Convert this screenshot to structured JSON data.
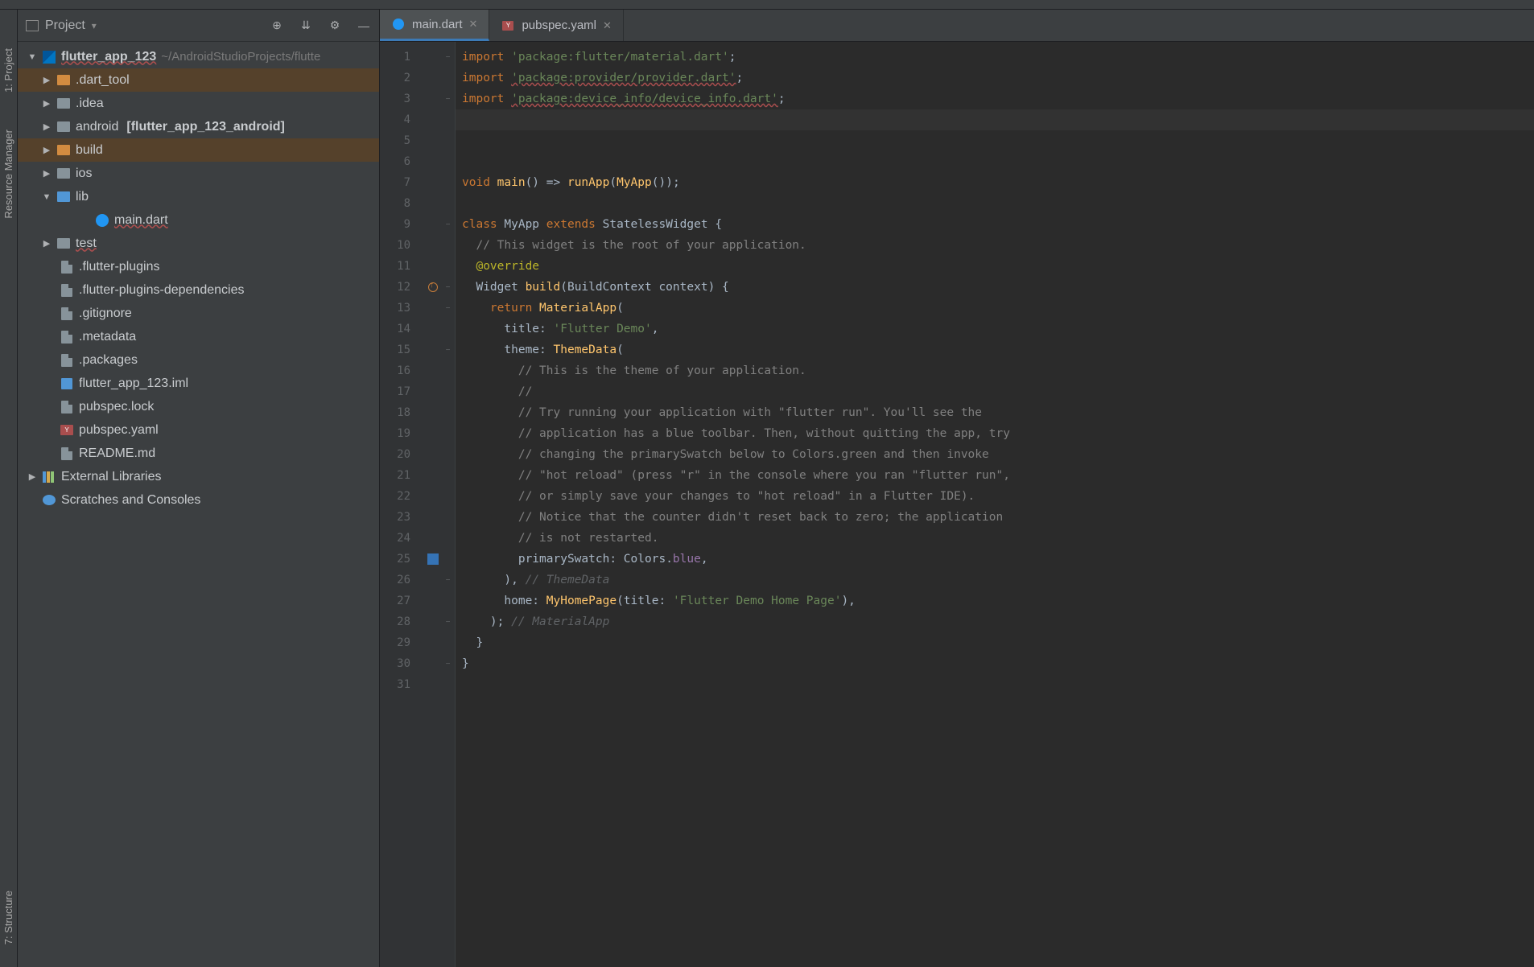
{
  "breadcrumb": "main.dart",
  "project_panel": {
    "title": "Project",
    "root_name": "flutter_app_123",
    "root_path": "~/AndroidStudioProjects/flutte",
    "items": {
      "dart_tool": ".dart_tool",
      "idea": ".idea",
      "android": "android",
      "android_module": "[flutter_app_123_android]",
      "build": "build",
      "ios": "ios",
      "lib": "lib",
      "main_dart": "main.dart",
      "test": "test",
      "flutter_plugins": ".flutter-plugins",
      "flutter_plugins_deps": ".flutter-plugins-dependencies",
      "gitignore": ".gitignore",
      "metadata": ".metadata",
      "packages": ".packages",
      "iml": "flutter_app_123.iml",
      "pubspec_lock": "pubspec.lock",
      "pubspec_yaml": "pubspec.yaml",
      "readme": "README.md"
    },
    "external_libs": "External Libraries",
    "scratches": "Scratches and Consoles"
  },
  "gutter": {
    "project": "1: Project",
    "resource": "Resource Manager",
    "structure": "7: Structure"
  },
  "tabs": [
    {
      "label": "main.dart",
      "active": true
    },
    {
      "label": "pubspec.yaml",
      "active": false
    }
  ],
  "code": {
    "l1a": "import ",
    "l1b": "'package:flutter/material.dart'",
    "l1c": ";",
    "l2a": "import ",
    "l2b": "'package:provider/provider.dart'",
    "l2c": ";",
    "l3a": "import ",
    "l3b": "'package:device_info/device_info.dart'",
    "l3c": ";",
    "l7a": "void ",
    "l7b": "main",
    "l7c": "() => ",
    "l7d": "runApp",
    "l7e": "(",
    "l7f": "MyApp",
    "l7g": "());",
    "l9a": "class ",
    "l9b": "MyApp ",
    "l9c": "extends ",
    "l9d": "StatelessWidget ",
    "l9e": "{",
    "l10": "// This widget is the root of your application.",
    "l11": "@override",
    "l12a": "Widget ",
    "l12b": "build",
    "l12c": "(BuildContext ",
    "l12d": "context",
    "l12e": ") {",
    "l13a": "return ",
    "l13b": "MaterialApp",
    "l13c": "(",
    "l14a": "title: ",
    "l14b": "'Flutter Demo'",
    "l14c": ",",
    "l15a": "theme: ",
    "l15b": "ThemeData",
    "l15c": "(",
    "l16": "// This is the theme of your application.",
    "l17": "//",
    "l18": "// Try running your application with \"flutter run\". You'll see the",
    "l19": "// application has a blue toolbar. Then, without quitting the app, try",
    "l20": "// changing the primarySwatch below to Colors.green and then invoke",
    "l21": "// \"hot reload\" (press \"r\" in the console where you ran \"flutter run\",",
    "l22": "// or simply save your changes to \"hot reload\" in a Flutter IDE).",
    "l23": "// Notice that the counter didn't reset back to zero; the application",
    "l24": "// is not restarted.",
    "l25a": "primarySwatch: ",
    "l25b": "Colors",
    "l25c": ".",
    "l25d": "blue",
    "l25e": ",",
    "l26a": "), ",
    "l26b": "// ThemeData",
    "l27a": "home: ",
    "l27b": "MyHomePage",
    "l27c": "(title: ",
    "l27d": "'Flutter Demo Home Page'",
    "l27e": "),",
    "l28a": "); ",
    "l28b": "// MaterialApp",
    "l29": "}",
    "l30": "}"
  },
  "line_numbers": [
    "1",
    "2",
    "3",
    "4",
    "5",
    "6",
    "7",
    "8",
    "9",
    "10",
    "11",
    "12",
    "13",
    "14",
    "15",
    "16",
    "17",
    "18",
    "19",
    "20",
    "21",
    "22",
    "23",
    "24",
    "25",
    "26",
    "27",
    "28",
    "29",
    "30",
    "31"
  ]
}
